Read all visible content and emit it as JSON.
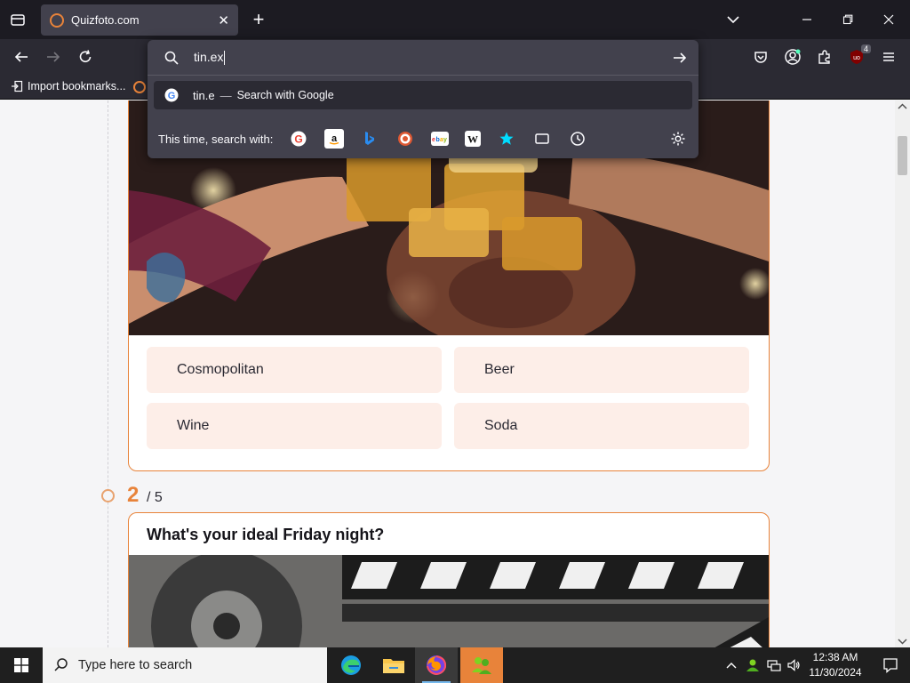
{
  "browser": {
    "tab": {
      "title": "Quizfoto.com"
    },
    "bookmarks": {
      "import_label": "Import bookmarks..."
    },
    "urlbar": {
      "typed_text": "tin.ex",
      "suggestion_text": "tin.e",
      "suggestion_separator": "—",
      "suggestion_action": "Search with Google",
      "search_with_label": "This time, search with:"
    },
    "extensions": {
      "ublock_badge": "4"
    }
  },
  "page": {
    "question1": {
      "answers": [
        "Cosmopolitan",
        "Beer",
        "Wine",
        "Soda"
      ]
    },
    "question2": {
      "number": "2",
      "total": "/ 5",
      "title": "What's your ideal Friday night?"
    }
  },
  "taskbar": {
    "search_placeholder": "Type here to search",
    "time": "12:38 AM",
    "date": "11/30/2024"
  },
  "colors": {
    "accent": "#e8833a",
    "answer_bg": "#fdeee8",
    "chrome_dark": "#1c1b22",
    "toolbar": "#2b2a33",
    "popup": "#42414d"
  }
}
